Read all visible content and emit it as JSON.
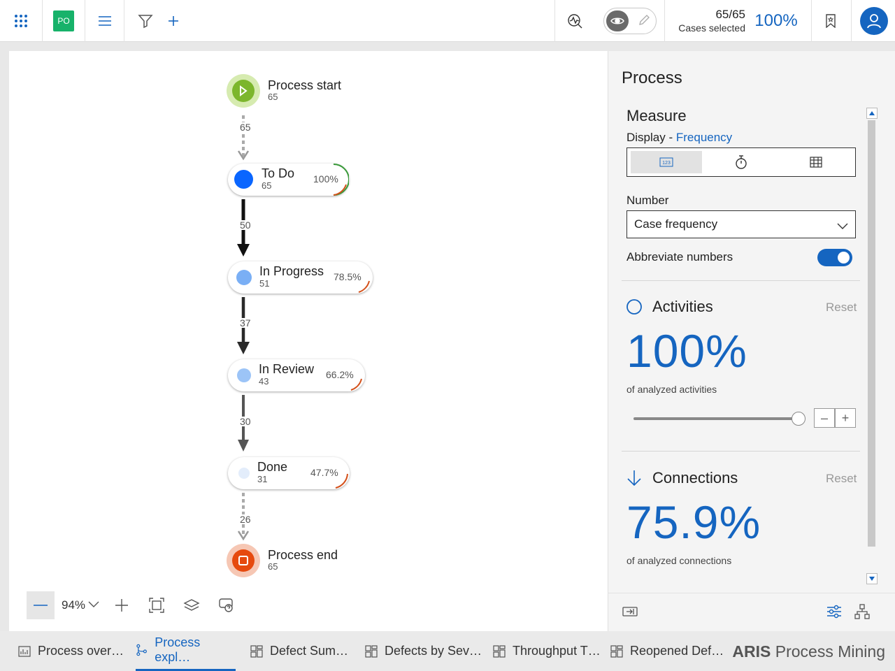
{
  "topbar": {
    "badge": "PO",
    "cases_count": "65/65",
    "cases_label": "Cases selected",
    "cases_percent": "100%"
  },
  "process": {
    "start": {
      "label": "Process start",
      "count": "65"
    },
    "end": {
      "label": "Process end",
      "count": "65"
    },
    "nodes": [
      {
        "name": "To Do",
        "count": "65",
        "percent": "100%",
        "color": "#0a66ff"
      },
      {
        "name": "In Progress",
        "count": "51",
        "percent": "78.5%",
        "color": "#7aaff5"
      },
      {
        "name": "In Review",
        "count": "43",
        "percent": "66.2%",
        "color": "#9cc4f7"
      },
      {
        "name": "Done",
        "count": "31",
        "percent": "47.7%",
        "color": "#e3edfb"
      }
    ],
    "edges": [
      "65",
      "50",
      "37",
      "30",
      "26"
    ]
  },
  "zoom": {
    "value": "94%"
  },
  "panel": {
    "title": "Process",
    "measure": {
      "title": "Measure",
      "display_label": "Display - ",
      "display_value": "Frequency",
      "number_label": "Number",
      "number_value": "Case frequency",
      "abbreviate_label": "Abbreviate numbers"
    },
    "activities": {
      "title": "Activities",
      "reset": "Reset",
      "value": "100%",
      "sub": "of analyzed activities"
    },
    "connections": {
      "title": "Connections",
      "reset": "Reset",
      "value": "75.9%",
      "sub": "of analyzed connections"
    }
  },
  "tabs": [
    {
      "label": "Process over…"
    },
    {
      "label": "Process expl…"
    },
    {
      "label": "Defect Sum…"
    },
    {
      "label": "Defects by Sev…"
    },
    {
      "label": "Throughput T…"
    },
    {
      "label": "Reopened Def…"
    }
  ],
  "brand": {
    "bold": "ARIS",
    "rest": " Process Mining"
  }
}
